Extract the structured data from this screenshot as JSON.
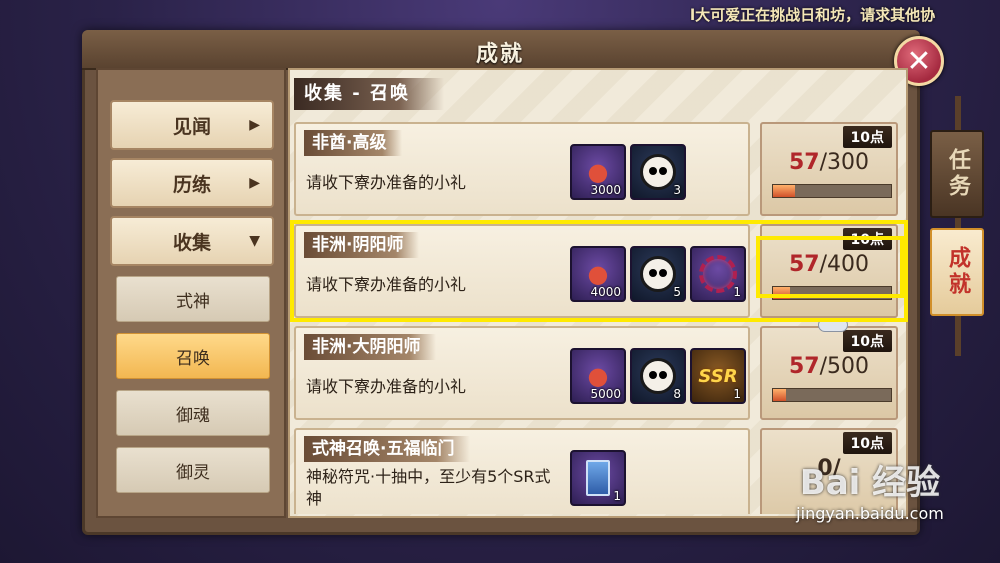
{
  "marquee": "l大可爱正在挑战日和坊，请求其他协",
  "window": {
    "title": "成就",
    "close_symbol": "✕"
  },
  "left_nav": {
    "items": [
      {
        "label": "见闻",
        "arrow": "▶"
      },
      {
        "label": "历练",
        "arrow": "▶"
      },
      {
        "label": "收集",
        "arrow": "▼"
      }
    ],
    "sub_items": [
      {
        "label": "式神",
        "active": false
      },
      {
        "label": "召唤",
        "active": true
      },
      {
        "label": "御魂",
        "active": false
      },
      {
        "label": "御灵",
        "active": false
      }
    ]
  },
  "section_title": "收集 - 召唤",
  "achievements": [
    {
      "name": "非酋·高级",
      "desc": "请收下寮办准备的小礼",
      "rewards": [
        {
          "icon": "gift-bag-icon",
          "count": "3000"
        },
        {
          "icon": "daruma-icon",
          "count": "3"
        }
      ],
      "points": "10点",
      "current": "57",
      "total": "/300",
      "progress": 0.19
    },
    {
      "name": "非洲·阴阳师",
      "desc": "请收下寮办准备的小礼",
      "rewards": [
        {
          "icon": "gift-bag-icon",
          "count": "4000"
        },
        {
          "icon": "daruma-icon",
          "count": "5"
        },
        {
          "icon": "avatar-frame-icon",
          "count": "1"
        }
      ],
      "points": "10点",
      "current": "57",
      "total": "/400",
      "progress": 0.1425
    },
    {
      "name": "非洲·大阴阳师",
      "desc": "请收下寮办准备的小礼",
      "rewards": [
        {
          "icon": "gift-bag-icon",
          "count": "5000"
        },
        {
          "icon": "daruma-icon",
          "count": "8"
        },
        {
          "icon": "ssr-icon",
          "count": "1",
          "label": "SSR"
        }
      ],
      "points": "10点",
      "current": "57",
      "total": "/500",
      "progress": 0.114
    },
    {
      "name": "式神召唤·五福临门",
      "desc": "神秘符咒·十抽中，至少有5个SR式神",
      "rewards": [
        {
          "icon": "mystery-talisman-icon",
          "count": "1"
        }
      ],
      "points": "10点",
      "current": "0/",
      "total": "",
      "progress": 0
    }
  ],
  "side_tabs": [
    {
      "label": "任务",
      "active": false
    },
    {
      "label": "成就",
      "active": true
    }
  ],
  "watermark": {
    "logo": "Bai 经验",
    "url": "jingyan.baidu.com"
  },
  "colors": {
    "highlight": "#ffea00",
    "current_value": "#b0262a",
    "active_sub": "#f2b751"
  }
}
